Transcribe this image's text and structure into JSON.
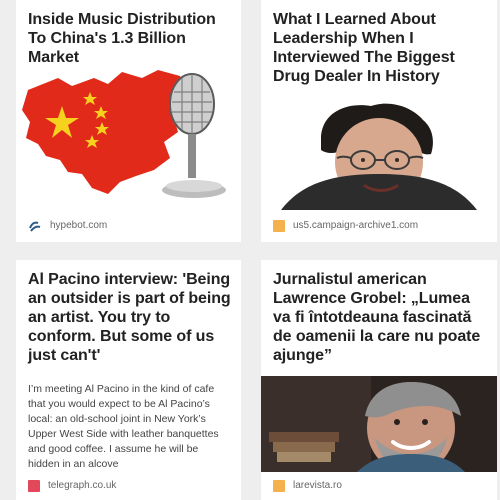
{
  "cards": [
    {
      "title": "Inside Music Distribution To China's 1.3 Billion Market",
      "source": "hypebot.com",
      "favicon": "hypebot-icon",
      "image": "china-map-microphone-illustration"
    },
    {
      "title": "What I Learned About Leadership When I Interviewed The Biggest Drug Dealer In History",
      "source": "us5.campaign-archive1.com",
      "favicon": "campaign-archive-icon",
      "image": "man-portrait-curly-hair-glasses",
      "favicon_color": "#f4b14c"
    },
    {
      "title": "Al Pacino interview: 'Being an outsider is part of being an artist. You try to conform. But some of us just can't'",
      "excerpt": "I’m meeting Al Pacino in the kind of cafe that you would expect to be Al Pacino’s local: an old-school joint in New York’s Upper West Side with leather banquettes and good coffee. I assume he will be hidden in an alcove",
      "source": "telegraph.co.uk",
      "favicon": "telegraph-icon",
      "favicon_color": "#e2475a"
    },
    {
      "title": "Jurnalistul american Lawrence Grobel: „Lumea va fi întotdeauna fascinată de oamenii la care nu poate ajunge”",
      "source": "larevista.ro",
      "favicon": "larevista-icon",
      "image": "smiling-man-with-books",
      "favicon_color": "#f4b14c"
    }
  ],
  "colors": {
    "background": "#eeeeee",
    "card": "#ffffff",
    "title": "#222222",
    "excerpt": "#444444",
    "source": "#666666",
    "china_red": "#e22a1a",
    "star_yellow": "#f6d21e"
  }
}
